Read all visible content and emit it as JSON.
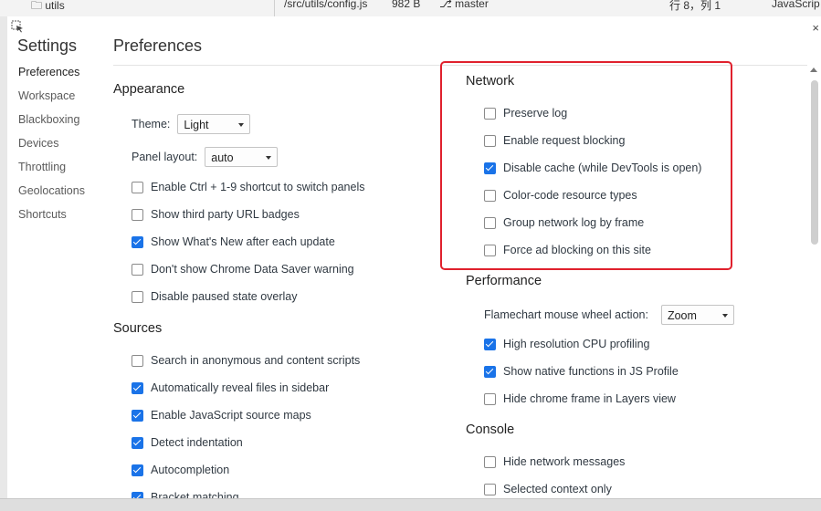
{
  "background": {
    "file_path": "/src/utils/config.js",
    "file_size": "982 B",
    "branch": "master",
    "cursor_pos": "行 8，列 1",
    "language": "JavaScrip",
    "folder_label": "utils"
  },
  "dialog": {
    "title": "Settings",
    "close_label": "×"
  },
  "nav": {
    "items": [
      "Preferences",
      "Workspace",
      "Blackboxing",
      "Devices",
      "Throttling",
      "Geolocations",
      "Shortcuts"
    ],
    "selected": "Preferences"
  },
  "content": {
    "title": "Preferences"
  },
  "appearance": {
    "heading": "Appearance",
    "theme_label": "Theme:",
    "theme_value": "Light",
    "panel_layout_label": "Panel layout:",
    "panel_layout_value": "auto",
    "options": [
      {
        "label": "Enable Ctrl + 1-9 shortcut to switch panels",
        "checked": false
      },
      {
        "label": "Show third party URL badges",
        "checked": false
      },
      {
        "label": "Show What's New after each update",
        "checked": true
      },
      {
        "label": "Don't show Chrome Data Saver warning",
        "checked": false
      },
      {
        "label": "Disable paused state overlay",
        "checked": false
      }
    ]
  },
  "sources": {
    "heading": "Sources",
    "options": [
      {
        "label": "Search in anonymous and content scripts",
        "checked": false
      },
      {
        "label": "Automatically reveal files in sidebar",
        "checked": true
      },
      {
        "label": "Enable JavaScript source maps",
        "checked": true
      },
      {
        "label": "Detect indentation",
        "checked": true
      },
      {
        "label": "Autocompletion",
        "checked": true
      },
      {
        "label": "Bracket matching",
        "checked": true
      }
    ]
  },
  "network": {
    "heading": "Network",
    "options": [
      {
        "label": "Preserve log",
        "checked": false
      },
      {
        "label": "Enable request blocking",
        "checked": false
      },
      {
        "label": "Disable cache (while DevTools is open)",
        "checked": true
      },
      {
        "label": "Color-code resource types",
        "checked": false
      },
      {
        "label": "Group network log by frame",
        "checked": false
      },
      {
        "label": "Force ad blocking on this site",
        "checked": false
      }
    ]
  },
  "performance": {
    "heading": "Performance",
    "flamechart_label": "Flamechart mouse wheel action:",
    "flamechart_value": "Zoom",
    "options": [
      {
        "label": "High resolution CPU profiling",
        "checked": true
      },
      {
        "label": "Show native functions in JS Profile",
        "checked": true
      },
      {
        "label": "Hide chrome frame in Layers view",
        "checked": false
      }
    ]
  },
  "console": {
    "heading": "Console",
    "options": [
      {
        "label": "Hide network messages",
        "checked": false
      },
      {
        "label": "Selected context only",
        "checked": false
      }
    ]
  },
  "colors": {
    "accent": "#1a73e8",
    "highlight_border": "#e0212d"
  }
}
